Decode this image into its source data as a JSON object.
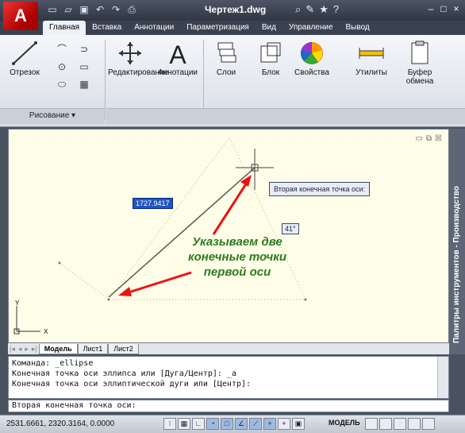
{
  "title_bar": {
    "document_title": "Чертеж1.dwg",
    "logo_letter": "A"
  },
  "ribbon_tabs": [
    "Главная",
    "Вставка",
    "Аннотации",
    "Параметризация",
    "Вид",
    "Управление",
    "Вывод"
  ],
  "ribbon": {
    "line_tool": "Отрезок",
    "modify_tool": "Редактирование",
    "annotation_tool": "Аннотации",
    "layers_tool": "Слои",
    "block_tool": "Блок",
    "properties_tool": "Свойства",
    "utilities_tool": "Утилиты",
    "clipboard_tool": "Буфер обмена",
    "draw_panel_label": "Рисование"
  },
  "drawing": {
    "dimension_value": "1727.9417",
    "angle_value": "41°",
    "tooltip": "Вторая конечная точка оси:",
    "note_lines": [
      "Указываем две",
      "конечные точки",
      "первой оси"
    ],
    "ucs_y": "Y",
    "ucs_x": "X"
  },
  "layout_tabs": [
    "Модель",
    "Лист1",
    "Лист2"
  ],
  "side_palette": "Палитры инструментов - Производство",
  "command_history": [
    "Команда: _ellipse",
    "Конечная точка оси эллипса или [Дуга/Центр]: _a",
    "Конечная точка оси эллиптической дуги или [Центр]:"
  ],
  "command_prompt": "Вторая конечная точка оси:",
  "status": {
    "coordinates": "2531.6661, 2320.3164, 0.0000",
    "model_label": "МОДЕЛЬ"
  }
}
